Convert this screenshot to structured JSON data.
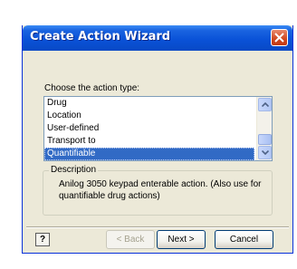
{
  "window": {
    "title": "Create Action Wizard"
  },
  "main": {
    "choose_label": "Choose the action type:",
    "list_items": [
      {
        "label": "Drug",
        "selected": false
      },
      {
        "label": "Location",
        "selected": false
      },
      {
        "label": "User-defined",
        "selected": false
      },
      {
        "label": "Transport to",
        "selected": false
      },
      {
        "label": "Quantifiable",
        "selected": true
      }
    ],
    "description": {
      "legend": "Description",
      "text": "Anilog 3050 keypad enterable action. (Also use for quantifiable drug actions)"
    }
  },
  "footer": {
    "help_label": "?",
    "back_label": "< Back",
    "next_label": "Next >",
    "cancel_label": "Cancel"
  },
  "colors": {
    "titlebar": "#0a52d8",
    "selection": "#316ac5",
    "dialog_bg": "#ece9d8",
    "close_button": "#d0461e"
  }
}
